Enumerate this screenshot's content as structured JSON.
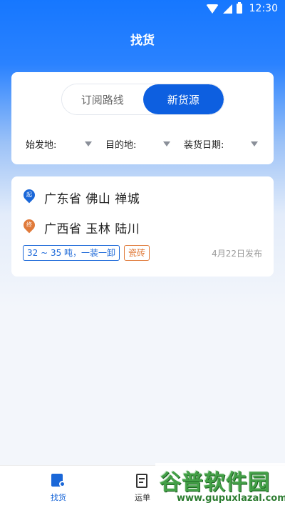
{
  "status_bar": {
    "time": "12:30"
  },
  "header": {
    "title": "找货"
  },
  "segment": {
    "tab_subscribe": "订阅路线",
    "tab_new": "新货源"
  },
  "filters": {
    "origin": "始发地:",
    "destination": "目的地:",
    "load_date": "装货日期:"
  },
  "cargo": {
    "origin_badge": "起",
    "origin": "广东省 佛山 禅城",
    "dest_badge": "终",
    "destination": "广西省 玉林 陆川",
    "tag_weight": "32 ~ 35 吨，一装一卸",
    "tag_goods": "瓷砖",
    "published": "4月22日发布"
  },
  "bottom_nav": {
    "find_goods": "找货",
    "waybill": "运单"
  },
  "watermark": {
    "brand": "谷普软件园",
    "url": "www.gupuxlazal.com"
  },
  "colors": {
    "primary": "#1677ff",
    "origin_pin": "#1a67d8",
    "dest_pin": "#e07a3a"
  }
}
